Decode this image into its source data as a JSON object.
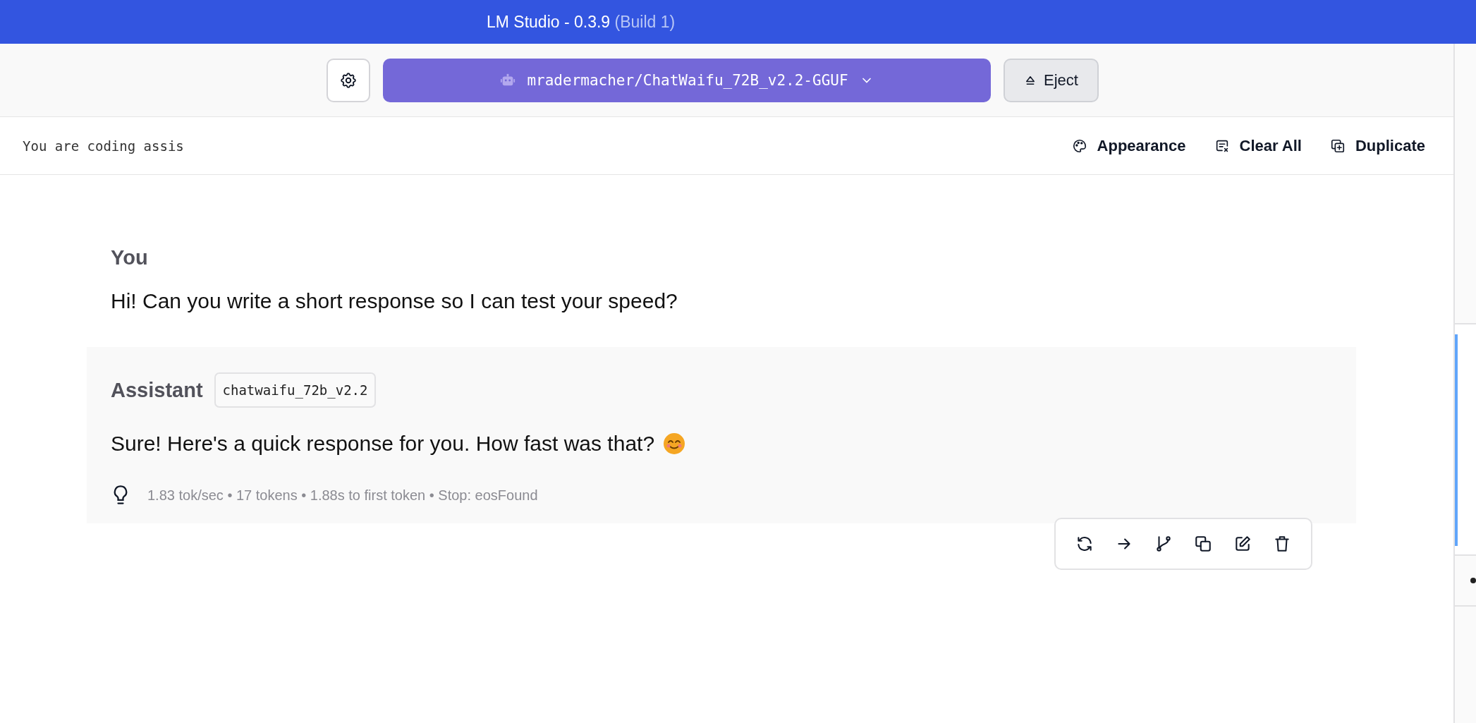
{
  "window": {
    "title": "LM Studio - 0.3.9",
    "build": "(Build 1)"
  },
  "toolbar": {
    "model": "mradermacher/ChatWaifu_72B_v2.2-GGUF",
    "eject": "Eject"
  },
  "system_prompt": "You are coding assis",
  "chat_actions": [
    {
      "kind": "appearance",
      "label": "Appearance"
    },
    {
      "kind": "clear",
      "label": "Clear All"
    },
    {
      "kind": "duplicate",
      "label": "Duplicate"
    }
  ],
  "messages": [
    {
      "role": "You",
      "text": "Hi! Can you write a short response so I can test your speed?"
    },
    {
      "role": "Assistant",
      "model_tag": "chatwaifu_72b_v2.2",
      "text": "Sure! Here's a quick response for you. How fast was that?",
      "stats": "1.83 tok/sec • 17 tokens • 1.88s to first token • Stop: eosFound",
      "actions": [
        {
          "kind": "regenerate"
        },
        {
          "kind": "continue"
        },
        {
          "kind": "branch"
        },
        {
          "kind": "copy"
        },
        {
          "kind": "edit"
        },
        {
          "kind": "delete"
        }
      ]
    }
  ]
}
